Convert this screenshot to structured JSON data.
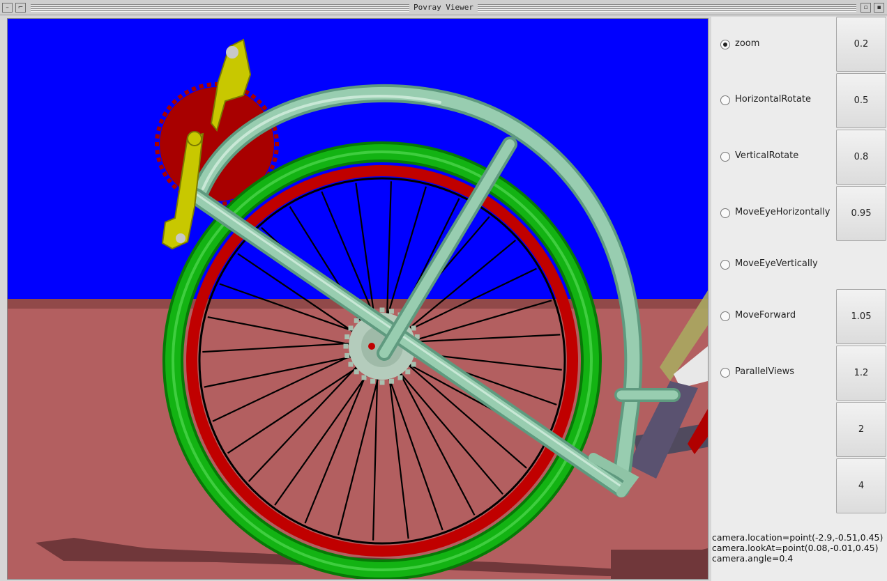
{
  "window": {
    "title": "Povray Viewer"
  },
  "controls": [
    {
      "label": "zoom",
      "selected": true,
      "value": "0.2"
    },
    {
      "label": "HorizontalRotate",
      "selected": false,
      "value": "0.5"
    },
    {
      "label": "VerticalRotate",
      "selected": false,
      "value": "0.8"
    },
    {
      "label": "MoveEyeHorizontally",
      "selected": false,
      "value": "0.95"
    },
    {
      "label": "MoveEyeVertically",
      "selected": false,
      "value": ""
    },
    {
      "label": "MoveForward",
      "selected": false,
      "value": "1.05"
    },
    {
      "label": "ParallelViews",
      "selected": false,
      "value": "1.2"
    },
    {
      "label": "",
      "selected": false,
      "value": "2"
    },
    {
      "label": "",
      "selected": false,
      "value": "4"
    }
  ],
  "camera": {
    "location": "camera.location=point(-2.9,-0.51,0.45)",
    "lookAt": "camera.lookAt=point(0.08,-0.01,0.45)",
    "angle": "camera.angle=0.4"
  },
  "colors": {
    "sky": "#0000ff",
    "floor": "#b35f60",
    "tire": "#0a9e0a",
    "rim": "#c00000",
    "frame": "#8fc4a6",
    "crank": "#c8c800",
    "sprocket": "#a80000"
  }
}
